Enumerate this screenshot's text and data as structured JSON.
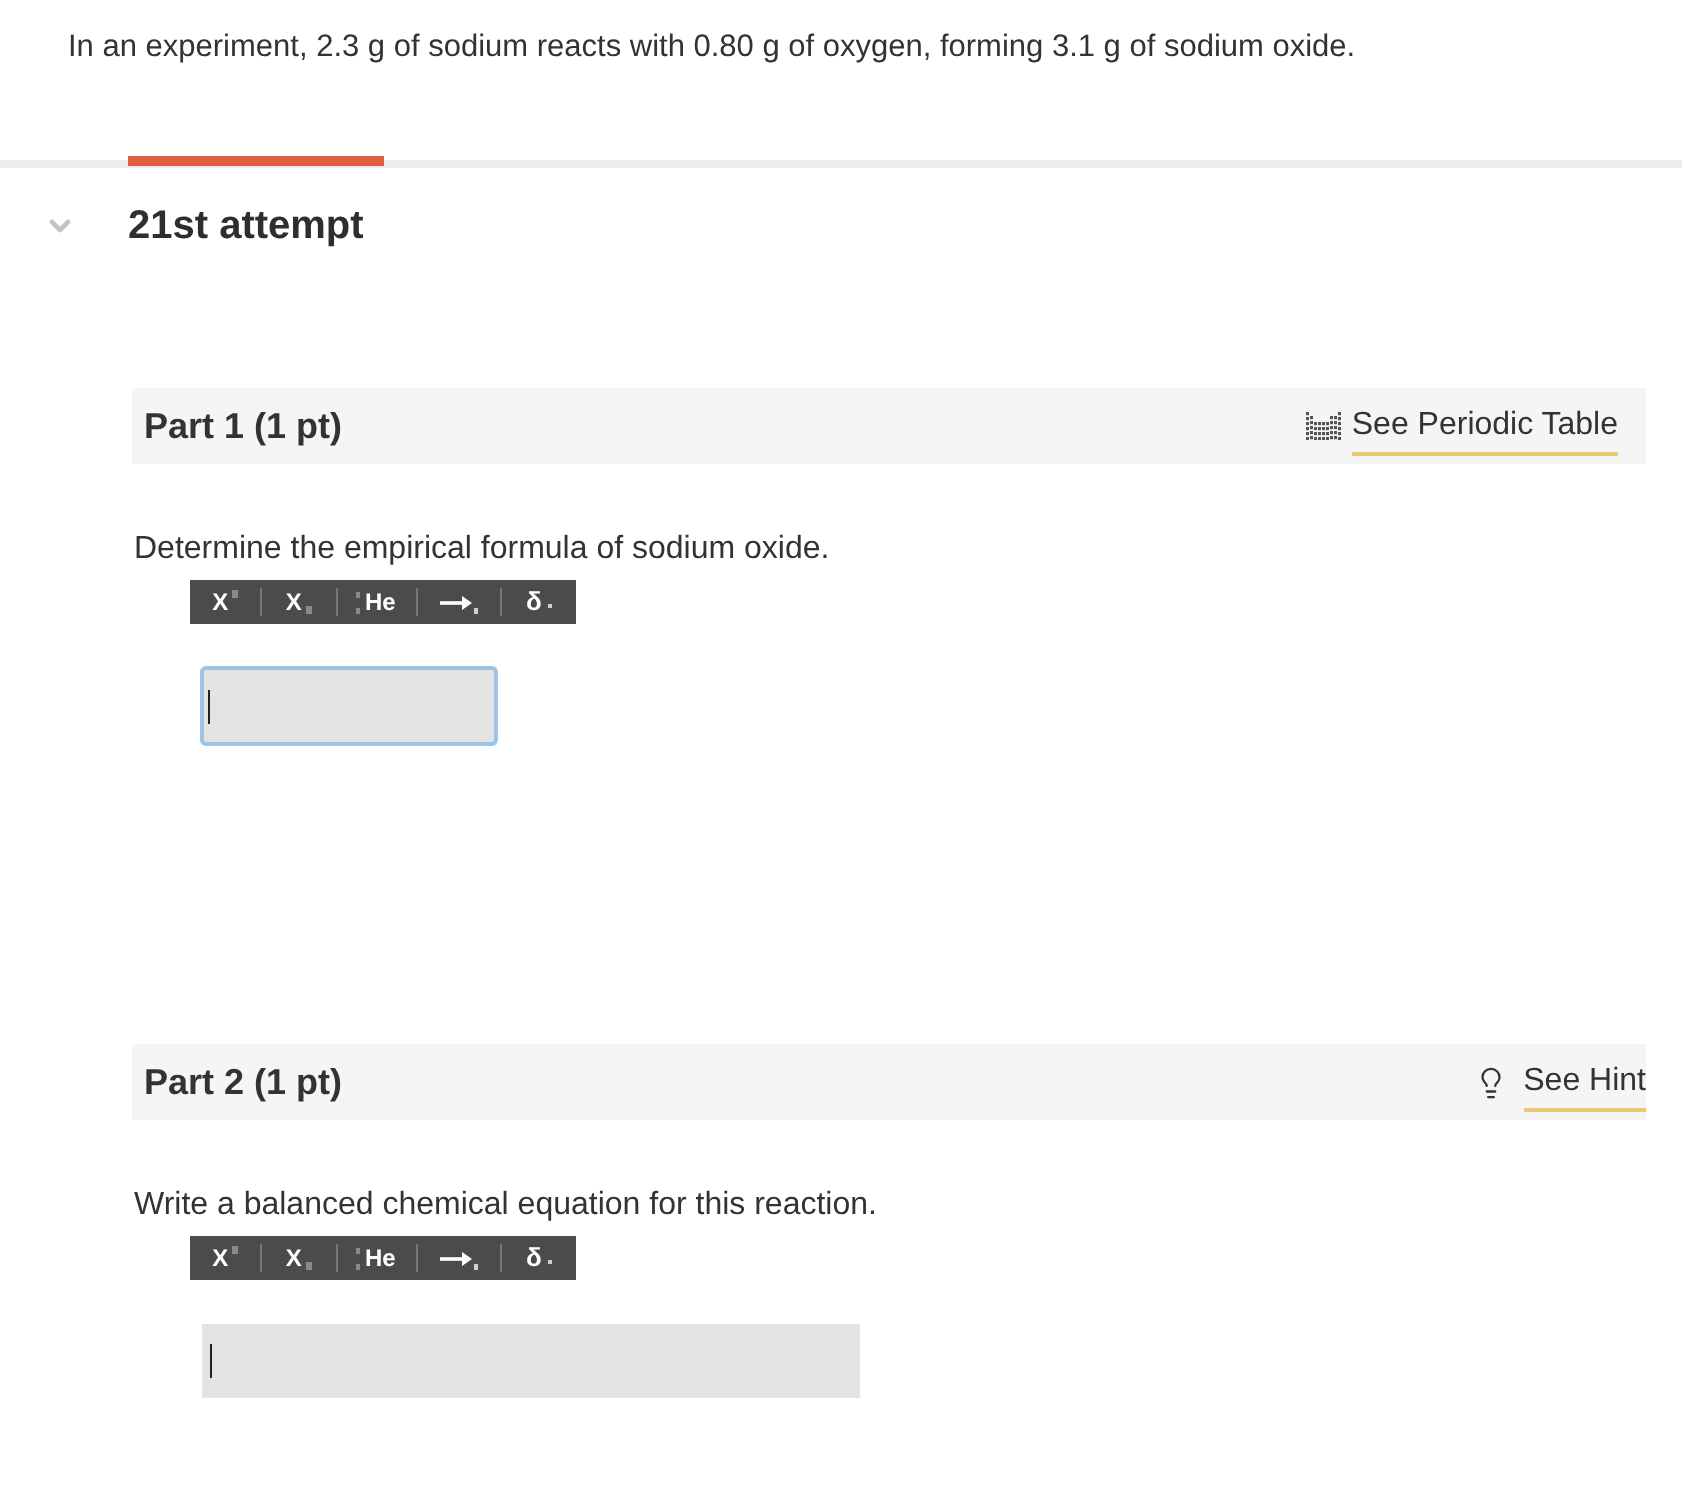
{
  "intro": "In an experiment, 2.3 g of sodium reacts with 0.80 g of oxygen, forming 3.1 g of sodium oxide.",
  "tabs": [
    {
      "selected": true
    }
  ],
  "attempt": {
    "title": "21st attempt",
    "expanded": true
  },
  "parts": [
    {
      "title": "Part 1 (1 pt)",
      "link": {
        "kind": "periodic_table",
        "label": "See Periodic Table"
      },
      "question": "Determine the empirical formula of sodium oxide.",
      "toolbar": [
        {
          "kind": "superscript",
          "label": "X"
        },
        {
          "kind": "subscript",
          "label": "X"
        },
        {
          "kind": "isotope",
          "label": "He"
        },
        {
          "kind": "arrow"
        },
        {
          "kind": "delta",
          "label": "δ"
        }
      ],
      "answer": {
        "kind": "formula",
        "focused": true
      }
    },
    {
      "title": "Part 2 (1 pt)",
      "link": {
        "kind": "hint",
        "label": "See Hint"
      },
      "question": "Write a balanced chemical equation for this reaction.",
      "toolbar": [
        {
          "kind": "superscript",
          "label": "X"
        },
        {
          "kind": "subscript",
          "label": "X"
        },
        {
          "kind": "isotope",
          "label": "He"
        },
        {
          "kind": "arrow"
        },
        {
          "kind": "delta",
          "label": "δ"
        }
      ],
      "answer": {
        "kind": "equation",
        "focused": false
      }
    }
  ]
}
